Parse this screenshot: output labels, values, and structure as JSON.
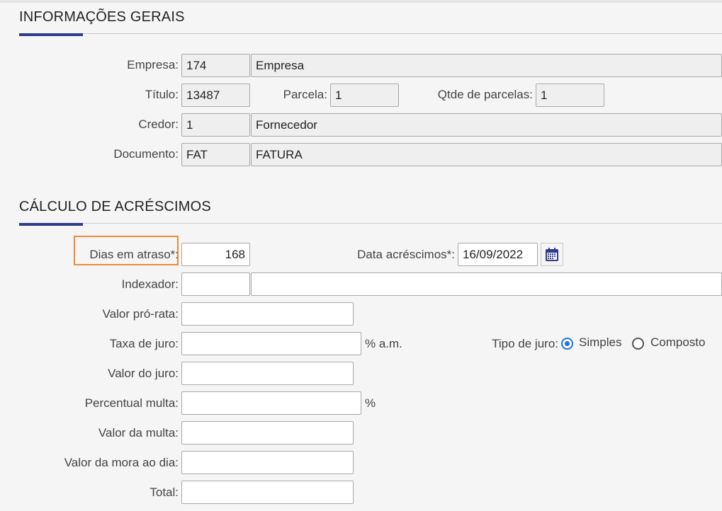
{
  "informacoes_gerais": {
    "title": "INFORMAÇÕES GERAIS",
    "empresa": {
      "label": "Empresa:",
      "code": "174",
      "name": "Empresa"
    },
    "titulo": {
      "label": "Título:",
      "value": "13487"
    },
    "parcela": {
      "label": "Parcela:",
      "value": "1"
    },
    "qtde_parcelas": {
      "label": "Qtde de parcelas:",
      "value": "1"
    },
    "credor": {
      "label": "Credor:",
      "code": "1",
      "name": "Fornecedor"
    },
    "documento": {
      "label": "Documento:",
      "code": "FAT",
      "name": "FATURA"
    }
  },
  "calculo_acrescimos": {
    "title": "CÁLCULO DE ACRÉSCIMOS",
    "dias_atraso": {
      "label": "Dias em atraso*:",
      "value": "168"
    },
    "data_acrescimos": {
      "label": "Data acréscimos*:",
      "value": "16/09/2022"
    },
    "indexador": {
      "label": "Indexador:",
      "code": "",
      "name": ""
    },
    "valor_pro_rata": {
      "label": "Valor pró-rata:",
      "value": ""
    },
    "taxa_juro": {
      "label": "Taxa de juro:",
      "value": "",
      "unit": "% a.m."
    },
    "tipo_juro": {
      "label": "Tipo de juro:",
      "options": [
        {
          "label": "Simples",
          "selected": true
        },
        {
          "label": "Composto",
          "selected": false
        }
      ]
    },
    "valor_juro": {
      "label": "Valor do juro:",
      "value": ""
    },
    "percentual_multa": {
      "label": "Percentual multa:",
      "value": "",
      "unit": "%"
    },
    "valor_multa": {
      "label": "Valor da multa:",
      "value": ""
    },
    "valor_mora_dia": {
      "label": "Valor da mora ao dia:",
      "value": ""
    },
    "total": {
      "label": "Total:",
      "value": ""
    }
  },
  "colors": {
    "accent": "#2e3a8c",
    "highlight": "#f08a32",
    "radio_selected": "#1a73e8",
    "calendar_icon": "#2e3a8c"
  },
  "icons": {
    "calendar": "calendar-icon"
  }
}
